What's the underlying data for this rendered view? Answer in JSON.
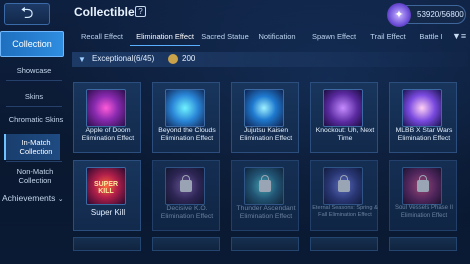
{
  "header": {
    "back_icon": "back-arrow-icon",
    "title": "Collectible",
    "help_icon": "info-icon",
    "currency_icon": "diamond-emblem-icon",
    "currency_text": "53920/56800"
  },
  "sidebar": {
    "active_label": "Collection",
    "items": [
      "Showcase",
      "Skins",
      "Chromatic Skins",
      "In-Match Collection",
      "Non-Match Collection"
    ],
    "bottom_label": "Achievements"
  },
  "tabs": [
    "Recall Effect",
    "Elimination Effect",
    "Sacred Statue",
    "Notification",
    "Spawn Effect",
    "Trail Effect",
    "Battle I"
  ],
  "filter": {
    "rank_label": "Exceptional(6/45)",
    "points": "200"
  },
  "cards": [
    {
      "name": "Apple of Doom Elimination Effect",
      "icon": "apple-of-doom-icon",
      "locked": false
    },
    {
      "name": "Beyond the Clouds Elimination Effect",
      "icon": "beyond-the-clouds-icon",
      "locked": false
    },
    {
      "name": "Jujutsu Kaisen Elimination Effect",
      "icon": "jujutsu-kaisen-icon",
      "locked": false
    },
    {
      "name": "Knockout: Uh, Next Time",
      "icon": "knockout-icon",
      "locked": false
    },
    {
      "name": "MLBB X Star Wars Elimination Effect",
      "icon": "star-wars-icon",
      "locked": false
    },
    {
      "name": "Super Kill",
      "icon": "super-kill-icon",
      "badge": "SUPER KILL",
      "locked": false
    },
    {
      "name": "Decisive K.O. Elimination Effect",
      "icon": "decisive-ko-icon",
      "locked": true
    },
    {
      "name": "Thunder Ascendant Elimination Effect",
      "icon": "thunder-ascendant-icon",
      "locked": true
    },
    {
      "name": "Eternal Seasons: Spring & Fall Elimination Effect",
      "icon": "eternal-seasons-icon",
      "locked": true
    },
    {
      "name": "Soul Vessels Phase II Elimination Effect",
      "icon": "soul-vessels-icon",
      "locked": true
    }
  ]
}
